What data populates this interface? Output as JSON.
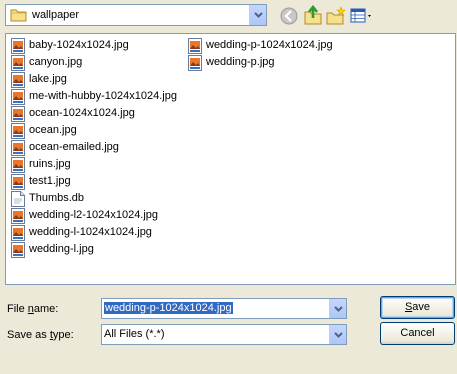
{
  "look_in": {
    "value": "wallpaper"
  },
  "toolbar": {
    "back_icon": "back-arrow-icon",
    "up_icon": "up-one-level-icon",
    "new_folder_icon": "new-folder-icon",
    "view_icon": "view-menu-icon"
  },
  "files_col1": [
    {
      "name": "baby-1024x1024.jpg",
      "type": "jpg"
    },
    {
      "name": "canyon.jpg",
      "type": "jpg"
    },
    {
      "name": "lake.jpg",
      "type": "jpg"
    },
    {
      "name": "me-with-hubby-1024x1024.jpg",
      "type": "jpg"
    },
    {
      "name": "ocean-1024x1024.jpg",
      "type": "jpg"
    },
    {
      "name": "ocean.jpg",
      "type": "jpg"
    },
    {
      "name": "ocean-emailed.jpg",
      "type": "jpg"
    },
    {
      "name": "ruins.jpg",
      "type": "jpg"
    },
    {
      "name": "test1.jpg",
      "type": "jpg"
    },
    {
      "name": "Thumbs.db",
      "type": "db"
    },
    {
      "name": "wedding-l2-1024x1024.jpg",
      "type": "jpg"
    },
    {
      "name": "wedding-l-1024x1024.jpg",
      "type": "jpg"
    },
    {
      "name": "wedding-l.jpg",
      "type": "jpg"
    }
  ],
  "files_col2": [
    {
      "name": "wedding-p-1024x1024.jpg",
      "type": "jpg"
    },
    {
      "name": "wedding-p.jpg",
      "type": "jpg"
    }
  ],
  "file_name": {
    "label_pre": "File ",
    "label_u": "n",
    "label_post": "ame:",
    "value": "wedding-p-1024x1024.jpg"
  },
  "save_as_type": {
    "label_pre": "Save as ",
    "label_u": "t",
    "label_post": "ype:",
    "value": "All Files (*.*)"
  },
  "buttons": {
    "save_u": "S",
    "save_rest": "ave",
    "cancel": "Cancel"
  },
  "colors": {
    "selection": "#316ac5",
    "dialog_bg": "#ece9d8",
    "border": "#7f9db9"
  }
}
